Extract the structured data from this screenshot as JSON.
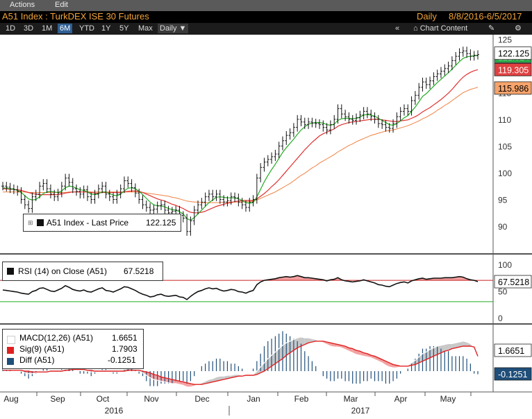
{
  "menu": {
    "actions": "Actions",
    "edit": "Edit"
  },
  "title": {
    "security": "A51 Index : TurkDEX ISE 30 Futures",
    "periodicity": "Daily",
    "date_range": "8/8/2016-6/5/2017"
  },
  "toolbar": {
    "ranges": [
      "1D",
      "3D",
      "1M",
      "6M",
      "YTD",
      "1Y",
      "5Y",
      "Max"
    ],
    "active_range": "6M",
    "frequency": "Daily",
    "collapse": "«",
    "chart_content": "Chart Content"
  },
  "price_legend": {
    "marker": "⊞",
    "label": "A51 Index - Last Price",
    "value": "122.125"
  },
  "rsi_legend": {
    "label": "RSI (14) on Close (A51)",
    "value": "67.5218"
  },
  "macd_legend": [
    {
      "label": "MACD(12,26) (A51)",
      "value": "1.6651",
      "color": "#ffffff"
    },
    {
      "label": "Sig(9) (A51)",
      "value": "1.7903",
      "color": "#e02020"
    },
    {
      "label": "Diff (A51)",
      "value": "-0.1251",
      "color": "#1f4e79"
    }
  ],
  "colors": {
    "price": "#111111",
    "ma_short": "#22aa22",
    "ma_mid": "#e03030",
    "ma_long": "#f08040",
    "rsi": "#111111",
    "rsi_upper": "#c82020",
    "rsi_lower": "#22aa22",
    "macd_sig": "#e02020",
    "hist": "#1f4e79"
  },
  "chart_data": [
    {
      "type": "line",
      "title": "A51 Index : TurkDEX ISE 30 Futures",
      "ylim": [
        86,
        126
      ],
      "yticks": [
        90,
        95,
        100,
        105,
        110,
        115,
        120,
        125
      ],
      "x_axis": {
        "months": [
          "Aug",
          "Sep",
          "Oct",
          "Nov",
          "Dec",
          "Jan",
          "Feb",
          "Mar",
          "Apr",
          "May"
        ],
        "years": [
          "2016",
          "2017"
        ]
      },
      "series": [
        {
          "name": "A51 Index - Last Price",
          "style": "ohlc",
          "last": 122.125,
          "values": [
            97.5,
            97.3,
            97.0,
            96.8,
            96.5,
            95.0,
            94.0,
            93.3,
            95.5,
            96.0,
            97.5,
            98.0,
            97.0,
            96.0,
            95.5,
            96.2,
            97.5,
            99.0,
            98.2,
            97.0,
            96.5,
            96.0,
            96.8,
            95.5,
            95.0,
            96.0,
            97.0,
            97.5,
            96.0,
            95.5,
            95.0,
            96.0,
            97.0,
            98.5,
            98.0,
            97.2,
            96.2,
            95.0,
            94.0,
            93.5,
            93.0,
            93.2,
            93.8,
            94.0,
            93.0,
            92.5,
            92.8,
            93.0,
            92.0,
            91.5,
            89.0,
            91.0,
            93.0,
            94.0,
            94.5,
            95.5,
            96.0,
            95.5,
            96.0,
            95.0,
            94.5,
            94.8,
            95.5,
            95.3,
            94.5,
            94.0,
            93.5,
            94.5,
            95.0,
            99.0,
            101.0,
            102.0,
            102.5,
            103.0,
            103.5,
            105.0,
            106.0,
            107.0,
            107.5,
            108.5,
            110.0,
            109.5,
            109.0,
            109.5,
            109.3,
            109.2,
            109.0,
            108.5,
            108.0,
            109.0,
            110.0,
            112.0,
            111.0,
            110.5,
            110.0,
            109.8,
            110.3,
            110.8,
            111.5,
            111.0,
            110.5,
            110.0,
            109.2,
            109.0,
            108.5,
            108.3,
            109.2,
            110.5,
            111.5,
            112.0,
            111.5,
            113.5,
            114.5,
            116.0,
            117.0,
            116.5,
            117.2,
            118.0,
            118.5,
            119.0,
            119.5,
            120.0,
            121.0,
            121.8,
            122.5,
            122.8,
            122.3,
            121.8,
            122.0,
            122.125
          ]
        },
        {
          "name": "MA short",
          "values": [
            97.2,
            97.1,
            97.0,
            96.9,
            96.7,
            96.3,
            95.7,
            95.1,
            94.9,
            95.0,
            95.5,
            96.1,
            96.4,
            96.5,
            96.4,
            96.3,
            96.6,
            97.2,
            97.5,
            97.4,
            97.1,
            96.8,
            96.7,
            96.4,
            96.0,
            95.9,
            96.1,
            96.4,
            96.4,
            96.1,
            95.8,
            95.7,
            96.0,
            96.6,
            97.1,
            97.2,
            97.0,
            96.5,
            95.9,
            95.2,
            94.5,
            94.0,
            93.8,
            93.8,
            93.6,
            93.3,
            93.1,
            93.0,
            92.7,
            92.3,
            91.4,
            91.1,
            91.6,
            92.3,
            93.0,
            93.7,
            94.4,
            94.9,
            95.4,
            95.5,
            95.4,
            95.3,
            95.3,
            95.3,
            95.1,
            94.8,
            94.4,
            94.3,
            94.4,
            95.5,
            96.9,
            98.3,
            99.5,
            100.6,
            101.6,
            102.7,
            103.8,
            104.7,
            105.5,
            106.3,
            107.2,
            108.0,
            108.6,
            109.1,
            109.3,
            109.4,
            109.4,
            109.3,
            109.0,
            108.9,
            109.1,
            109.8,
            110.1,
            110.2,
            110.2,
            110.1,
            110.2,
            110.4,
            110.8,
            110.9,
            110.8,
            110.6,
            110.2,
            109.8,
            109.4,
            109.0,
            108.9,
            109.2,
            109.7,
            110.3,
            110.7,
            111.5,
            112.3,
            113.3,
            114.3,
            114.8,
            115.5,
            116.2,
            116.9,
            117.5,
            118.1,
            118.7,
            119.4,
            120.1,
            120.8,
            121.4,
            121.7,
            121.8,
            121.9,
            121.9
          ]
        },
        {
          "name": "MA mid",
          "values": [
            97.0,
            97.0,
            96.9,
            96.9,
            96.8,
            96.7,
            96.5,
            96.3,
            96.1,
            96.0,
            95.9,
            95.9,
            95.9,
            95.9,
            95.9,
            95.9,
            96.0,
            96.2,
            96.3,
            96.4,
            96.4,
            96.4,
            96.4,
            96.4,
            96.3,
            96.2,
            96.2,
            96.3,
            96.3,
            96.3,
            96.3,
            96.3,
            96.3,
            96.4,
            96.5,
            96.6,
            96.6,
            96.5,
            96.3,
            96.0,
            95.7,
            95.4,
            95.1,
            94.9,
            94.7,
            94.4,
            94.1,
            93.9,
            93.6,
            93.3,
            92.9,
            92.6,
            92.5,
            92.5,
            92.6,
            92.8,
            93.1,
            93.4,
            93.7,
            93.9,
            94.1,
            94.3,
            94.4,
            94.6,
            94.7,
            94.8,
            94.8,
            94.8,
            94.8,
            95.1,
            95.6,
            96.1,
            96.7,
            97.4,
            98.0,
            98.7,
            99.5,
            100.3,
            101.1,
            101.9,
            102.7,
            103.5,
            104.3,
            105.0,
            105.7,
            106.3,
            106.9,
            107.3,
            107.6,
            107.9,
            108.2,
            108.7,
            109.0,
            109.2,
            109.4,
            109.5,
            109.6,
            109.7,
            109.8,
            109.9,
            110.0,
            110.0,
            110.0,
            109.9,
            109.8,
            109.7,
            109.6,
            109.6,
            109.7,
            109.8,
            109.9,
            110.2,
            110.5,
            110.9,
            111.4,
            111.8,
            112.2,
            112.7,
            113.2,
            113.7,
            114.3,
            114.9,
            115.6,
            116.4,
            117.2,
            117.9,
            118.4,
            118.8,
            119.1,
            119.305
          ]
        },
        {
          "name": "MA long",
          "values": [
            96.4,
            96.4,
            96.4,
            96.4,
            96.4,
            96.4,
            96.4,
            96.3,
            96.3,
            96.3,
            96.3,
            96.3,
            96.3,
            96.3,
            96.3,
            96.3,
            96.3,
            96.3,
            96.4,
            96.4,
            96.4,
            96.4,
            96.4,
            96.4,
            96.4,
            96.4,
            96.4,
            96.4,
            96.4,
            96.4,
            96.4,
            96.4,
            96.4,
            96.4,
            96.4,
            96.4,
            96.4,
            96.4,
            96.3,
            96.2,
            96.1,
            96.0,
            95.9,
            95.8,
            95.7,
            95.6,
            95.4,
            95.3,
            95.1,
            94.9,
            94.7,
            94.6,
            94.5,
            94.5,
            94.4,
            94.4,
            94.4,
            94.4,
            94.4,
            94.4,
            94.5,
            94.5,
            94.5,
            94.5,
            94.5,
            94.5,
            94.6,
            94.6,
            94.7,
            94.9,
            95.2,
            95.5,
            95.8,
            96.1,
            96.4,
            96.8,
            97.2,
            97.6,
            98.0,
            98.5,
            99.0,
            99.5,
            99.9,
            100.4,
            100.9,
            101.3,
            101.8,
            102.2,
            102.6,
            103.0,
            103.4,
            103.9,
            104.3,
            104.7,
            105.1,
            105.4,
            105.8,
            106.1,
            106.4,
            106.7,
            107.0,
            107.2,
            107.4,
            107.6,
            107.8,
            107.9,
            108.0,
            108.2,
            108.4,
            108.6,
            108.8,
            109.1,
            109.4,
            109.7,
            110.1,
            110.4,
            110.8,
            111.2,
            111.7,
            112.1,
            112.6,
            113.0,
            113.5,
            114.0,
            114.5,
            115.0,
            115.3,
            115.6,
            115.8,
            115.986
          ]
        }
      ],
      "labels": [
        "122.125",
        "121.024",
        "119.305",
        "115.986"
      ]
    },
    {
      "type": "line",
      "title": "RSI (14) on Close (A51)",
      "ylim": [
        -5,
        105
      ],
      "yticks": [
        0,
        50,
        100
      ],
      "reference_lines": [
        70,
        30
      ],
      "series": [
        {
          "name": "RSI (14) on Close (A51)",
          "last": 67.5218,
          "values": [
            52,
            51,
            50,
            49,
            48,
            46,
            45,
            44,
            49,
            51,
            55,
            56,
            53,
            50,
            49,
            52,
            55,
            60,
            57,
            53,
            51,
            50,
            52,
            49,
            48,
            51,
            54,
            56,
            51,
            50,
            48,
            51,
            54,
            58,
            57,
            54,
            51,
            47,
            44,
            42,
            39,
            40,
            43,
            44,
            41,
            40,
            41,
            42,
            39,
            38,
            34,
            40,
            45,
            49,
            51,
            54,
            56,
            54,
            55,
            52,
            50,
            51,
            53,
            52,
            49,
            48,
            46,
            49,
            51,
            62,
            67,
            70,
            71,
            72,
            73,
            75,
            76,
            77,
            76,
            77,
            79,
            77,
            75,
            75,
            74,
            73,
            72,
            71,
            69,
            71,
            72,
            75,
            71,
            69,
            68,
            67,
            68,
            69,
            71,
            69,
            67,
            65,
            62,
            61,
            59,
            58,
            61,
            64,
            66,
            67,
            65,
            69,
            71,
            73,
            74,
            72,
            73,
            74,
            74,
            74,
            75,
            75,
            75,
            76,
            77,
            76,
            73,
            71,
            70,
            67.52
          ]
        }
      ],
      "labels": [
        "67.5218"
      ]
    },
    {
      "type": "line",
      "title": "MACD(12,26) (A51)",
      "ylim": [
        -3.5,
        4.5
      ],
      "series": [
        {
          "name": "MACD(12,26) (A51)",
          "last": 1.6651,
          "values": [
            0.2,
            0.2,
            0.2,
            0.1,
            0.1,
            0.0,
            -0.2,
            -0.3,
            -0.3,
            -0.2,
            -0.1,
            0.0,
            0.0,
            0.0,
            0.0,
            0.0,
            0.1,
            0.2,
            0.3,
            0.3,
            0.2,
            0.1,
            0.1,
            0.0,
            -0.1,
            -0.1,
            0.0,
            0.1,
            0.1,
            0.0,
            -0.1,
            -0.1,
            0.0,
            0.2,
            0.3,
            0.3,
            0.2,
            0.0,
            -0.2,
            -0.5,
            -0.8,
            -1.0,
            -1.1,
            -1.2,
            -1.3,
            -1.4,
            -1.5,
            -1.5,
            -1.6,
            -1.7,
            -1.9,
            -1.9,
            -1.8,
            -1.6,
            -1.4,
            -1.2,
            -1.0,
            -0.9,
            -0.7,
            -0.6,
            -0.6,
            -0.5,
            -0.5,
            -0.4,
            -0.4,
            -0.5,
            -0.5,
            -0.5,
            -0.4,
            0.0,
            0.5,
            1.0,
            1.5,
            1.9,
            2.3,
            2.7,
            3.1,
            3.4,
            3.6,
            3.8,
            4.0,
            4.1,
            4.0,
            4.0,
            3.9,
            3.8,
            3.6,
            3.4,
            3.2,
            3.0,
            2.9,
            2.9,
            2.8,
            2.6,
            2.4,
            2.2,
            2.0,
            1.9,
            1.8,
            1.7,
            1.6,
            1.4,
            1.2,
            1.0,
            0.7,
            0.5,
            0.4,
            0.4,
            0.5,
            0.6,
            0.7,
            1.0,
            1.3,
            1.7,
            2.1,
            2.3,
            2.6,
            2.8,
            3.0,
            3.1,
            3.2,
            3.3,
            3.3,
            3.4,
            3.5,
            3.6,
            3.5,
            3.3,
            2.8,
            1.6651
          ]
        },
        {
          "name": "Sig(9) (A51)",
          "last": 1.7903,
          "values": [
            0.1,
            0.1,
            0.1,
            0.1,
            0.1,
            0.1,
            0.0,
            0.0,
            -0.1,
            -0.1,
            -0.1,
            -0.1,
            -0.1,
            0.0,
            0.0,
            0.0,
            0.0,
            0.1,
            0.1,
            0.2,
            0.2,
            0.2,
            0.2,
            0.1,
            0.1,
            0.0,
            0.0,
            0.0,
            0.0,
            0.0,
            0.0,
            0.0,
            0.0,
            0.0,
            0.1,
            0.1,
            0.1,
            0.1,
            0.0,
            -0.1,
            -0.2,
            -0.4,
            -0.5,
            -0.7,
            -0.8,
            -0.9,
            -1.0,
            -1.1,
            -1.2,
            -1.3,
            -1.4,
            -1.5,
            -1.6,
            -1.6,
            -1.6,
            -1.5,
            -1.4,
            -1.3,
            -1.2,
            -1.1,
            -1.0,
            -0.9,
            -0.8,
            -0.7,
            -0.6,
            -0.6,
            -0.5,
            -0.5,
            -0.5,
            -0.4,
            -0.2,
            0.0,
            0.3,
            0.6,
            0.9,
            1.2,
            1.5,
            1.9,
            2.2,
            2.5,
            2.8,
            3.0,
            3.2,
            3.4,
            3.5,
            3.6,
            3.6,
            3.6,
            3.5,
            3.4,
            3.3,
            3.2,
            3.1,
            3.0,
            2.8,
            2.7,
            2.5,
            2.4,
            2.2,
            2.1,
            1.9,
            1.8,
            1.6,
            1.4,
            1.2,
            1.0,
            0.8,
            0.7,
            0.6,
            0.6,
            0.6,
            0.7,
            0.8,
            1.0,
            1.2,
            1.4,
            1.6,
            1.8,
            2.0,
            2.2,
            2.4,
            2.5,
            2.7,
            2.8,
            2.9,
            3.0,
            3.0,
            3.0,
            2.9,
            1.7903
          ]
        },
        {
          "name": "Diff (A51)",
          "last": -0.1251,
          "style": "histogram",
          "values": []
        }
      ],
      "labels": [
        "1.6651",
        "-0.1251"
      ]
    }
  ]
}
